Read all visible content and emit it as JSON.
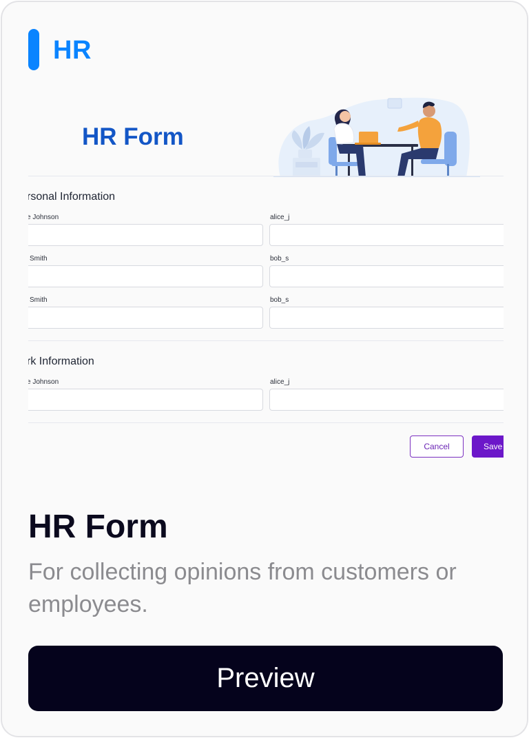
{
  "card": {
    "category": "HR",
    "title": "HR Form",
    "description": "For collecting opinions from customers or employees.",
    "preview_button": "Preview"
  },
  "form_preview": {
    "title": "HR Form",
    "sections": [
      {
        "title": "rsonal Information",
        "rows": [
          {
            "left_label": "e Johnson",
            "right_label": "alice_j"
          },
          {
            "left_label": "Smith",
            "right_label": "bob_s"
          },
          {
            "left_label": "Smith",
            "right_label": "bob_s"
          }
        ]
      },
      {
        "title": "rk Information",
        "rows": [
          {
            "left_label": "e Johnson",
            "right_label": "alice_j"
          }
        ]
      }
    ],
    "cancel_label": "Cancel",
    "save_label": "Save"
  },
  "colors": {
    "accent": "#0a84ff",
    "form_title": "#1356c6",
    "button_primary": "#6c17c9",
    "card_button": "#05031c",
    "description": "#8b8b8f"
  }
}
